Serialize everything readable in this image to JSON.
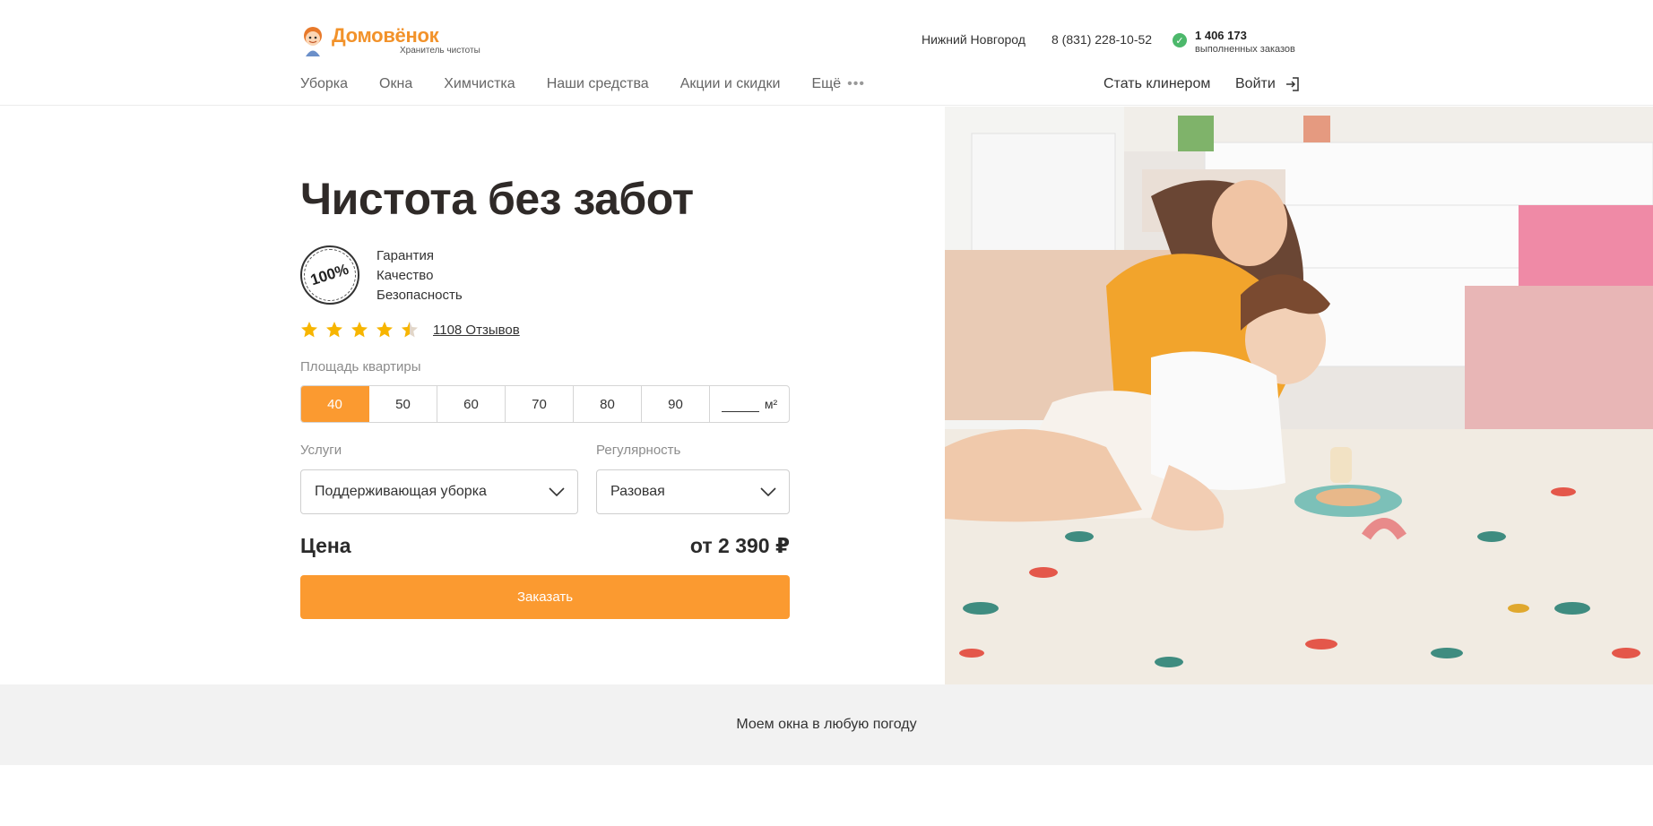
{
  "header": {
    "brand_name": "Домовёнок",
    "brand_tagline": "Хранитель чистоты",
    "city": "Нижний Новгород",
    "phone": "8 (831) 228-10-52",
    "orders_count": "1 406 173",
    "orders_label": "выполненных заказов"
  },
  "nav": {
    "items": [
      "Уборка",
      "Окна",
      "Химчистка",
      "Наши средства",
      "Акции и скидки"
    ],
    "more_label": "Ещё",
    "become_cleaner": "Стать клинером",
    "login": "Войти"
  },
  "hero": {
    "title": "Чистота без забот",
    "badge_text": "100%",
    "features": [
      "Гарантия",
      "Качество",
      "Безопасность"
    ],
    "rating": 4.5,
    "reviews_link": "1108 Отзывов"
  },
  "form": {
    "area_label": "Площадь квартиры",
    "area_options": [
      "40",
      "50",
      "60",
      "70",
      "80",
      "90"
    ],
    "area_selected": "40",
    "area_unit": "м²",
    "services_label": "Услуги",
    "services_value": "Поддерживающая уборка",
    "frequency_label": "Регулярность",
    "frequency_value": "Разовая",
    "price_label": "Цена",
    "price_value": "от 2 390 ₽",
    "order_button": "Заказать"
  },
  "banner": {
    "text": "Моем окна в любую погоду"
  },
  "colors": {
    "accent": "#fb9a30",
    "brand": "#f2922a",
    "check": "#4cb86b",
    "star": "#f7b500",
    "banner_bg": "#f2f2f2"
  }
}
